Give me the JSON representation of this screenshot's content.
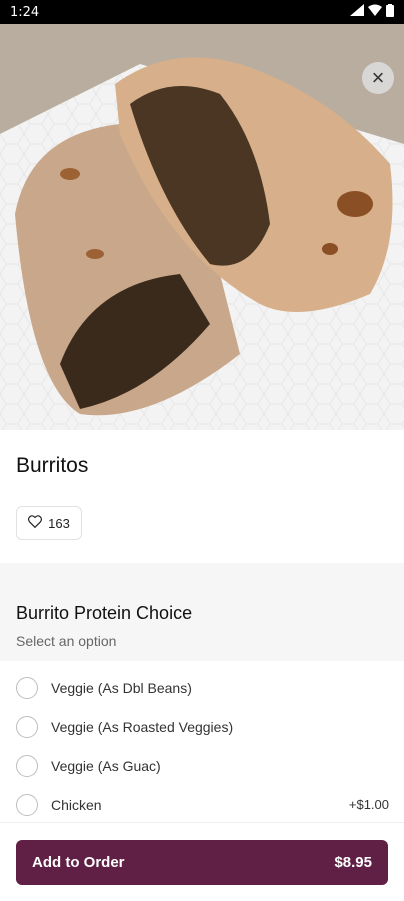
{
  "status_bar": {
    "time": "1:24",
    "icons": [
      "signal-icon",
      "wifi-icon",
      "battery-icon"
    ]
  },
  "item": {
    "title": "Burritos",
    "likes": "163"
  },
  "section": {
    "title": "Burrito Protein Choice",
    "subtitle": "Select an option"
  },
  "options": [
    {
      "label": "Veggie (As Dbl Beans)",
      "price": ""
    },
    {
      "label": "Veggie (As Roasted Veggies)",
      "price": ""
    },
    {
      "label": "Veggie (As Guac)",
      "price": ""
    },
    {
      "label": "Chicken",
      "price": "+$1.00"
    }
  ],
  "footer": {
    "button_label": "Add to Order",
    "price": "$8.95"
  },
  "colors": {
    "accent": "#601f44"
  }
}
